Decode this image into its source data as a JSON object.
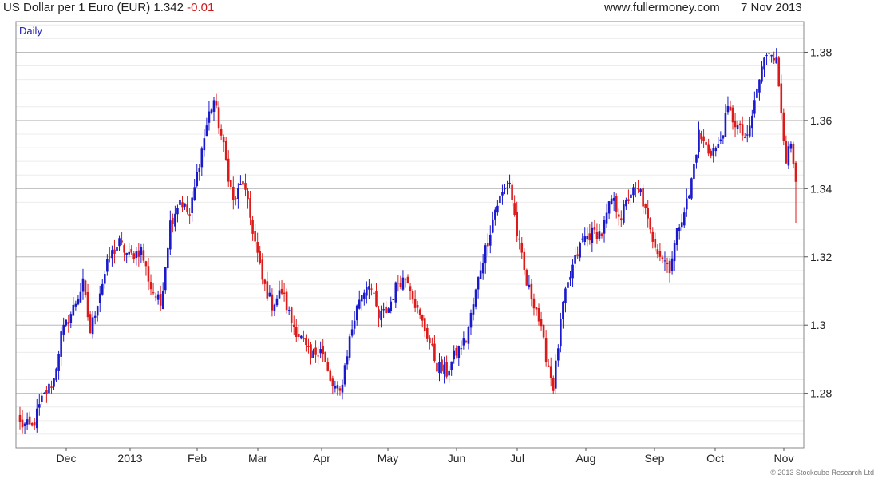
{
  "header": {
    "instrument": "US Dollar per 1 Euro (EUR)",
    "last": "1.342",
    "change": "-0.01",
    "site": "www.fullermoney.com",
    "date": "7 Nov 2013"
  },
  "copyright": "© 2013 Stockcube Research Ltd",
  "colors": {
    "up": "#1a1acc",
    "down": "#dd1a1a",
    "grid": "#dddddd",
    "frame": "#888888"
  },
  "chart_data": {
    "type": "candlestick",
    "periodicity": "Daily",
    "y_ticks": [
      1.28,
      1.3,
      1.32,
      1.34,
      1.36,
      1.38
    ],
    "y_tick_labels": [
      "1.28",
      "1.3",
      "1.32",
      "1.34",
      "1.36",
      "1.38"
    ],
    "ylim": [
      1.264,
      1.389
    ],
    "x_month_labels": [
      "Dec",
      "2013",
      "Feb",
      "Mar",
      "Apr",
      "May",
      "Jun",
      "Jul",
      "Aug",
      "Sep",
      "Oct",
      "Nov"
    ],
    "grid": true,
    "anchors": [
      [
        0,
        1.271
      ],
      [
        5,
        1.27
      ],
      [
        9,
        1.278
      ],
      [
        14,
        1.284
      ],
      [
        17,
        1.297
      ],
      [
        22,
        1.305
      ],
      [
        26,
        1.312
      ],
      [
        29,
        1.298
      ],
      [
        33,
        1.31
      ],
      [
        37,
        1.32
      ],
      [
        41,
        1.324
      ],
      [
        45,
        1.32
      ],
      [
        50,
        1.322
      ],
      [
        54,
        1.311
      ],
      [
        58,
        1.306
      ],
      [
        62,
        1.33
      ],
      [
        66,
        1.337
      ],
      [
        70,
        1.332
      ],
      [
        74,
        1.348
      ],
      [
        78,
        1.362
      ],
      [
        80,
        1.366
      ],
      [
        84,
        1.352
      ],
      [
        88,
        1.336
      ],
      [
        92,
        1.342
      ],
      [
        96,
        1.328
      ],
      [
        100,
        1.313
      ],
      [
        104,
        1.306
      ],
      [
        108,
        1.31
      ],
      [
        112,
        1.301
      ],
      [
        116,
        1.296
      ],
      [
        120,
        1.29
      ],
      [
        124,
        1.294
      ],
      [
        128,
        1.283
      ],
      [
        132,
        1.28
      ],
      [
        136,
        1.296
      ],
      [
        140,
        1.308
      ],
      [
        144,
        1.313
      ],
      [
        148,
        1.302
      ],
      [
        152,
        1.305
      ],
      [
        156,
        1.313
      ],
      [
        160,
        1.314
      ],
      [
        164,
        1.304
      ],
      [
        168,
        1.297
      ],
      [
        172,
        1.288
      ],
      [
        176,
        1.286
      ],
      [
        180,
        1.292
      ],
      [
        184,
        1.296
      ],
      [
        187,
        1.306
      ],
      [
        190,
        1.317
      ],
      [
        193,
        1.325
      ],
      [
        196,
        1.334
      ],
      [
        200,
        1.34
      ],
      [
        202,
        1.342
      ],
      [
        205,
        1.327
      ],
      [
        209,
        1.312
      ],
      [
        213,
        1.305
      ],
      [
        217,
        1.291
      ],
      [
        220,
        1.282
      ],
      [
        224,
        1.306
      ],
      [
        228,
        1.317
      ],
      [
        232,
        1.325
      ],
      [
        236,
        1.327
      ],
      [
        240,
        1.327
      ],
      [
        244,
        1.337
      ],
      [
        248,
        1.332
      ],
      [
        252,
        1.339
      ],
      [
        256,
        1.339
      ],
      [
        260,
        1.327
      ],
      [
        264,
        1.321
      ],
      [
        268,
        1.317
      ],
      [
        272,
        1.33
      ],
      [
        276,
        1.338
      ],
      [
        280,
        1.356
      ],
      [
        284,
        1.351
      ],
      [
        288,
        1.352
      ],
      [
        292,
        1.363
      ],
      [
        296,
        1.358
      ],
      [
        300,
        1.354
      ],
      [
        304,
        1.369
      ],
      [
        306,
        1.375
      ],
      [
        308,
        1.38
      ],
      [
        310,
        1.381
      ],
      [
        312,
        1.377
      ],
      [
        316,
        1.349
      ],
      [
        318,
        1.352
      ],
      [
        320,
        1.342
      ]
    ],
    "last_close": 1.342
  }
}
